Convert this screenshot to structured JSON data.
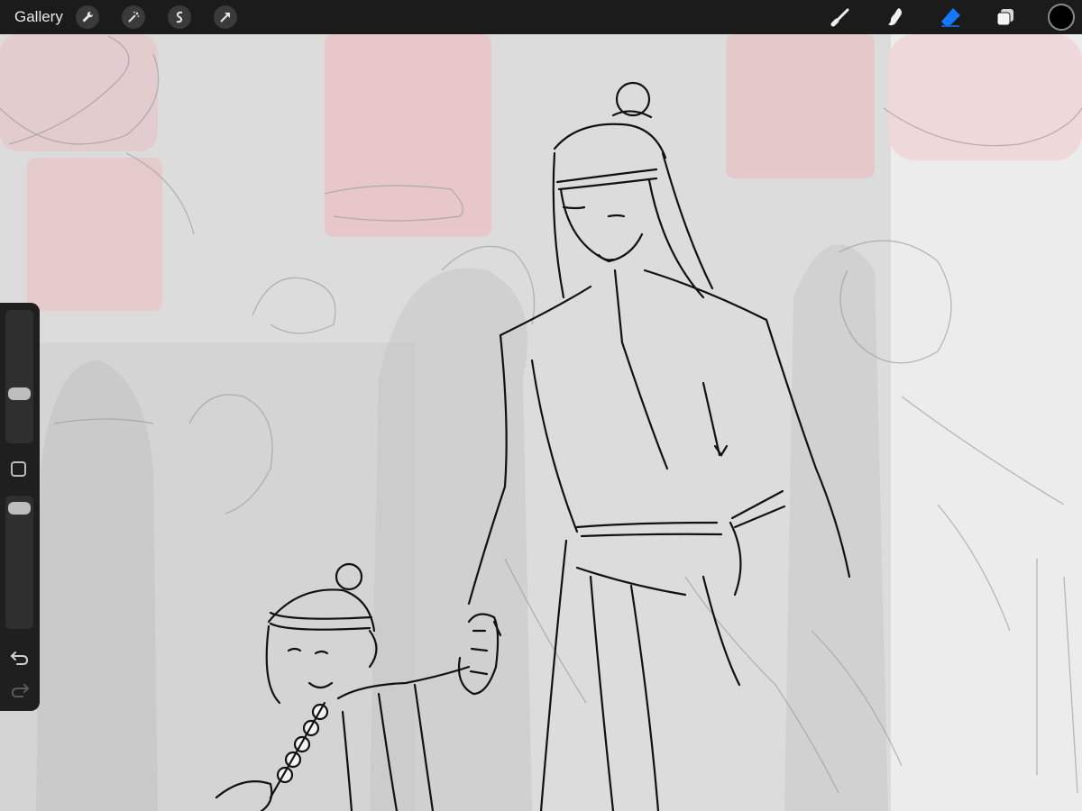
{
  "topbar": {
    "gallery_label": "Gallery",
    "left_tools": [
      "wrench-icon",
      "magic-wand-icon",
      "selection-icon",
      "transform-arrow-icon"
    ],
    "right_tools": [
      "brush-icon",
      "smudge-icon",
      "eraser-icon",
      "layers-icon"
    ],
    "active_tool": "eraser-icon",
    "active_color": "#1677ff",
    "current_color": "#000000"
  },
  "sidebar": {
    "brush_size_level": 0.25,
    "opacity_level": 0.05,
    "icons": [
      "modify-square-icon",
      "undo-icon",
      "redo-icon"
    ]
  }
}
